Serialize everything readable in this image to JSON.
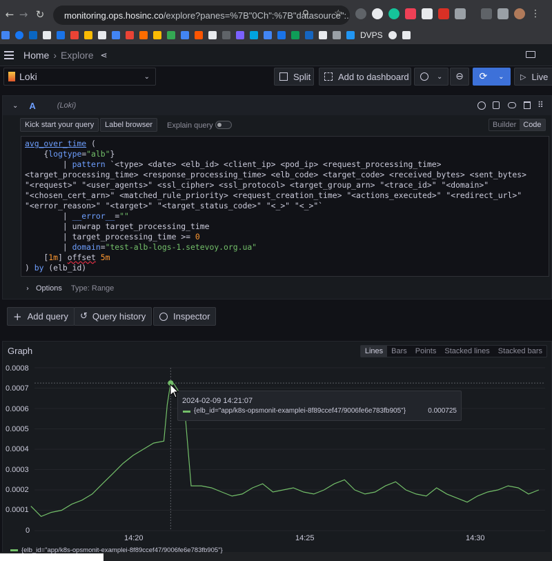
{
  "browser": {
    "url_host": "monitoring.ops.hosinc.co",
    "url_path": "/explore?panes=%7B\"0Ch\":%7B\"datasource\":...",
    "bookmark_text": "DVPS"
  },
  "header": {
    "home": "Home",
    "sep": "›",
    "explore": "Explore"
  },
  "toolbar": {
    "datasource": "Loki",
    "split": "Split",
    "add_to_dashboard": "Add to dashboard",
    "live": "Live"
  },
  "query": {
    "ref_id": "A",
    "ds_note": "(Loki)",
    "kick_start": "Kick start your query",
    "label_browser": "Label browser",
    "explain": "Explain query",
    "mode_builder": "Builder",
    "mode_code": "Code",
    "options_label": "Options",
    "options_type": "Type: Range"
  },
  "actions": {
    "add_query": "Add query",
    "query_history": "Query history",
    "inspector": "Inspector"
  },
  "graph": {
    "title": "Graph",
    "modes": [
      "Lines",
      "Bars",
      "Points",
      "Stacked lines",
      "Stacked bars"
    ],
    "active_mode": "Lines"
  },
  "tooltip": {
    "time": "2024-02-09 14:21:07",
    "series": "{elb_id=\"app/k8s-opsmonit-examplei-8f89ccef47/9006fe6e783fb905\"}",
    "value": "0.000725"
  },
  "legend": {
    "series": "{elb_id=\"app/k8s-opsmonit-examplei-8f89ccef47/9006fe6e783fb905\"}"
  },
  "chart_data": {
    "type": "line",
    "xlabel": "",
    "ylabel": "",
    "y_ticks": [
      "0.0008",
      "0.0007",
      "0.0006",
      "0.0005",
      "0.0004",
      "0.0003",
      "0.0002",
      "0.0001",
      "0"
    ],
    "x_ticks": [
      "14:20",
      "14:25",
      "14:30"
    ],
    "ylim": [
      0,
      0.0008
    ],
    "colors": {
      "series": "#73bf69"
    },
    "series": [
      {
        "name": "{elb_id=\"app/k8s-opsmonit-examplei-8f89ccef47/9006fe6e783fb905\"}",
        "x_minutes": [
          17.0,
          17.3,
          17.6,
          17.9,
          18.2,
          18.5,
          18.8,
          19.1,
          19.4,
          19.7,
          20.0,
          20.3,
          20.6,
          20.9,
          21.0,
          21.1,
          21.2,
          21.35,
          21.5,
          21.7,
          22.0,
          22.3,
          22.6,
          22.9,
          23.2,
          23.5,
          23.8,
          24.1,
          24.4,
          24.7,
          25.0,
          25.3,
          25.6,
          25.9,
          26.2,
          26.5,
          26.8,
          27.1,
          27.4,
          27.7,
          28.0,
          28.3,
          28.6,
          28.9,
          29.2,
          29.5,
          29.8,
          30.1,
          30.4,
          30.7,
          31.0,
          31.3,
          31.6,
          31.9
        ],
        "values": [
          0.00012,
          7e-05,
          9e-05,
          0.0001,
          0.00013,
          0.00015,
          0.00018,
          0.00023,
          0.00028,
          0.00033,
          0.00037,
          0.0004,
          0.00043,
          0.00044,
          0.00062,
          0.000725,
          0.00072,
          0.00068,
          0.00062,
          0.00022,
          0.00022,
          0.00021,
          0.00019,
          0.00017,
          0.00018,
          0.00021,
          0.00023,
          0.00019,
          0.0002,
          0.00021,
          0.00019,
          0.00018,
          0.0002,
          0.00023,
          0.00025,
          0.0002,
          0.00018,
          0.00019,
          0.00022,
          0.00024,
          0.0002,
          0.00018,
          0.00017,
          0.00021,
          0.00018,
          0.00016,
          0.00014,
          0.00017,
          0.00019,
          0.0002,
          0.00022,
          0.00021,
          0.00018,
          0.0002
        ]
      }
    ],
    "hover_x_minutes": 21.1
  }
}
